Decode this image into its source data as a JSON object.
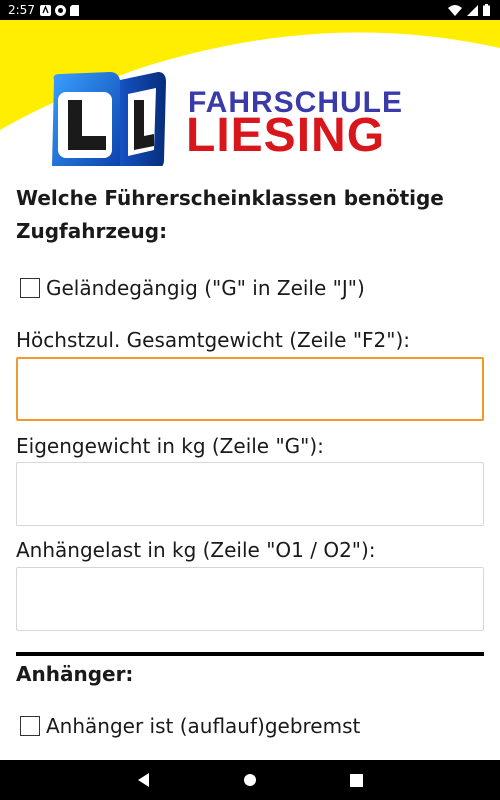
{
  "status_bar": {
    "time": "2:57"
  },
  "header": {
    "brand_line1": "FAHRSCHULE",
    "brand_line2": "LIESING",
    "colors": {
      "yellow": "#ffee00",
      "blue": "#3a3aa8",
      "red": "#d8161c"
    }
  },
  "form": {
    "tow_vehicle_heading": "Welche Führerscheinklassen benötige Zugfahrzeug:",
    "offroad_checkbox": {
      "label": "Geländegängig (\"G\" in Zeile \"J\")",
      "checked": false
    },
    "max_weight": {
      "label": "Höchstzul. Gesamtgewicht (Zeile \"F2\"):",
      "value": ""
    },
    "own_weight": {
      "label": "Eigengewicht in kg (Zeile \"G\"):",
      "value": ""
    },
    "towing_capacity": {
      "label": "Anhängelast in kg  (Zeile \"O1 / O2\"):",
      "value": ""
    },
    "trailer_heading": "Anhänger:",
    "trailer_braked_checkbox": {
      "label": "Anhänger ist (auflauf)gebremst",
      "checked": false
    },
    "focus_color": "#f39a2e"
  },
  "nav_bar": {
    "buttons": [
      "back-icon",
      "home-icon",
      "recents-icon"
    ]
  }
}
